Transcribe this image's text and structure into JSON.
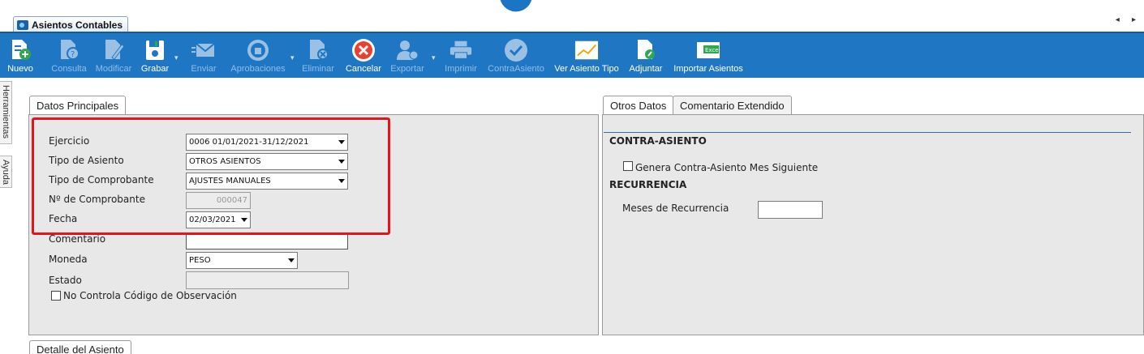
{
  "window": {
    "tab_title": "Asientos Contables"
  },
  "toolbar": {
    "buttons": [
      {
        "label": "Nuevo",
        "enabled": true,
        "icon": "document-plus-icon"
      },
      {
        "label": "Consulta",
        "enabled": false,
        "icon": "document-question-icon"
      },
      {
        "label": "Modificar",
        "enabled": false,
        "icon": "document-edit-icon"
      },
      {
        "label": "Grabar",
        "enabled": true,
        "icon": "save-disk-icon"
      },
      {
        "label": "Enviar",
        "enabled": false,
        "icon": "envelope-icon"
      },
      {
        "label": "Aprobaciones",
        "enabled": false,
        "icon": "thumbs-up-icon"
      },
      {
        "label": "Eliminar",
        "enabled": false,
        "icon": "document-delete-icon"
      },
      {
        "label": "Cancelar",
        "enabled": true,
        "icon": "cancel-x-icon"
      },
      {
        "label": "Exportar",
        "enabled": false,
        "icon": "user-export-icon"
      },
      {
        "label": "Imprimir",
        "enabled": false,
        "icon": "printer-icon"
      },
      {
        "label": "ContraAsiento",
        "enabled": false,
        "icon": "check-circle-icon"
      },
      {
        "label": "Ver Asiento Tipo",
        "enabled": true,
        "icon": "chart-line-icon"
      },
      {
        "label": "Adjuntar",
        "enabled": true,
        "icon": "paperclip-document-icon"
      },
      {
        "label": "Importar Asientos",
        "enabled": true,
        "icon": "excel-icon",
        "badge": "Excel"
      }
    ]
  },
  "side_tabs": {
    "tools": "Herramientas",
    "help": "Ayuda"
  },
  "main": {
    "tab": "Datos Principales",
    "fields": {
      "ejercicio": {
        "label": "Ejercicio",
        "value": "0006 01/01/2021-31/12/2021"
      },
      "tipo_asiento": {
        "label": "Tipo de Asiento",
        "value": "OTROS ASIENTOS"
      },
      "tipo_comprobante": {
        "label": "Tipo de Comprobante",
        "value": "AJUSTES MANUALES"
      },
      "nro_comprobante": {
        "label": "Nº de Comprobante",
        "value": "000047"
      },
      "fecha": {
        "label": "Fecha",
        "value": "02/03/2021"
      },
      "comentario": {
        "label": "Comentario",
        "value": ""
      },
      "moneda": {
        "label": "Moneda",
        "value": "PESO"
      },
      "estado": {
        "label": "Estado",
        "value": ""
      },
      "no_controla": {
        "label": "No Controla Código de Observación",
        "checked": false
      }
    }
  },
  "right": {
    "tabs": [
      "Otros Datos",
      "Comentario Extendido"
    ],
    "contra_asiento": {
      "heading": "CONTRA-ASIENTO",
      "checkbox_label": "Genera Contra-Asiento Mes Siguiente",
      "checked": false
    },
    "recurrencia": {
      "heading": "RECURRENCIA",
      "meses_label": "Meses de Recurrencia",
      "meses_value": ""
    }
  },
  "detail": {
    "tab": "Detalle del Asiento"
  },
  "colors": {
    "toolbar_bg": "#1f77c4",
    "highlight": "#e8141b",
    "panel_bg": "#e8e8e8"
  }
}
